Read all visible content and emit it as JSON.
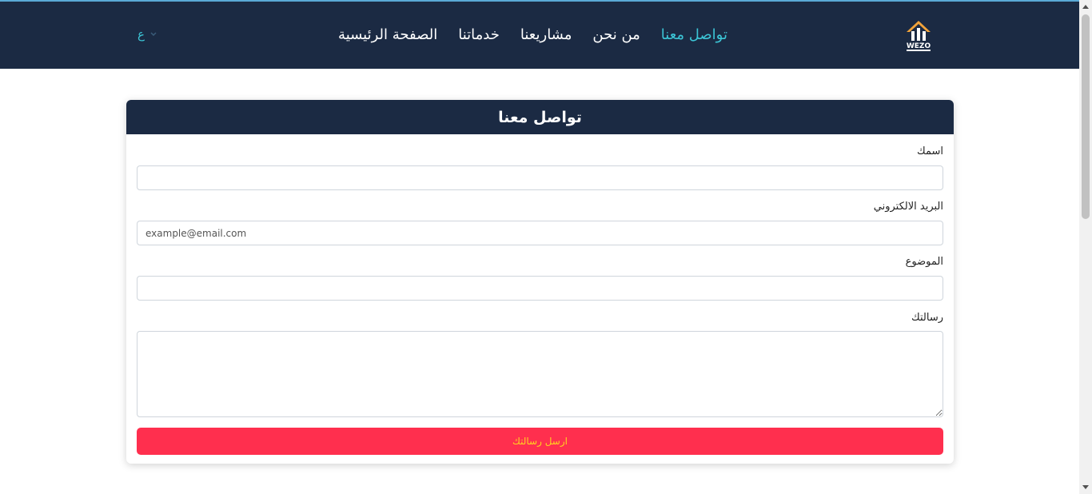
{
  "colors": {
    "navbar_bg": "#1b2a43",
    "accent": "#3cc5d6",
    "submit_bg": "#ff2f4e",
    "submit_text": "#ffd21f"
  },
  "logo": {
    "text": "WEZO",
    "icon": "house-logo-icon"
  },
  "nav": {
    "items": [
      {
        "label": "الصفحة الرئيسية",
        "active": false
      },
      {
        "label": "خدماتنا",
        "active": false
      },
      {
        "label": "مشاريعنا",
        "active": false
      },
      {
        "label": "من نحن",
        "active": false
      },
      {
        "label": "تواصل معنا",
        "active": true
      }
    ],
    "language": {
      "label": "ع",
      "icon": "chevron-down-icon"
    }
  },
  "form": {
    "title": "تواصل معنا",
    "name": {
      "label": "اسمك",
      "value": "",
      "placeholder": ""
    },
    "email": {
      "label": "البريد الالكتروني",
      "value": "",
      "placeholder": "example@email.com"
    },
    "subject": {
      "label": "الموضوع",
      "value": "",
      "placeholder": ""
    },
    "message": {
      "label": "رسالتك",
      "value": "",
      "placeholder": ""
    },
    "submit_label": "ارسل رسالتك"
  }
}
